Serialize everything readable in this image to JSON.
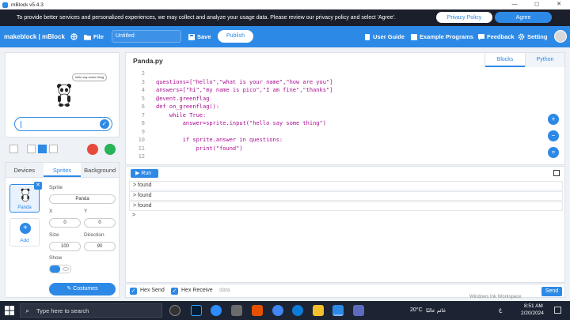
{
  "titlebar": {
    "title": "mBlock v5.4.3",
    "min": "—",
    "max": "◻",
    "close": "✕"
  },
  "privacy": {
    "message": "To provide better services and personalized experiences, we may collect and analyze your usage data. Please review our privacy policy and select 'Agree'.",
    "policy_label": "Privacy Policy",
    "agree_label": "Agree"
  },
  "menubar": {
    "logo": "makeblock | mBlock",
    "file": "File",
    "project_title": "Untitled",
    "save": "Save",
    "publish": "Publish",
    "user_guide": "User Guide",
    "example_programs": "Example Programs",
    "feedback": "Feedback",
    "setting": "Setting"
  },
  "stage": {
    "bubble_text": "hello say some thing"
  },
  "sprites_panel": {
    "tabs": [
      "Devices",
      "Sprites",
      "Background"
    ],
    "sprite_card_label": "Panda",
    "add_label": "Add",
    "sprite_label": "Sprite",
    "sprite_name": "Panda",
    "x_label": "X",
    "y_label": "Y",
    "x_value": "0",
    "y_value": "0",
    "size_label": "Size",
    "direction_label": "Direction",
    "size_value": "100",
    "direction_value": "90",
    "show_label": "Show",
    "costumes_label": "Costumes"
  },
  "editor": {
    "filename": "Panda.py",
    "mode_tabs": [
      "Blocks",
      "Python"
    ],
    "lines": [
      {
        "n": "2",
        "code": ""
      },
      {
        "n": "3",
        "code": "questions=[\"hello\",\"what is your name\",\"how are you\"]"
      },
      {
        "n": "4",
        "code": "answers=[\"hi\",\"my name is pico\",\"I am fine\",\"thanks\"]"
      },
      {
        "n": "5",
        "code": "@event.greenflag"
      },
      {
        "n": "6",
        "code": "def on_greenflag():"
      },
      {
        "n": "7",
        "code": "    while True:"
      },
      {
        "n": "8",
        "code": "        answer=sprite.input(\"hello say some thing\")"
      },
      {
        "n": "9",
        "code": ""
      },
      {
        "n": "10",
        "code": "        if sprite.answer in questions:"
      },
      {
        "n": "11",
        "code": "            print(\"found\")"
      },
      {
        "n": "12",
        "code": ""
      }
    ]
  },
  "console": {
    "run_label": "Run",
    "rows": [
      "found",
      "found",
      "found",
      ""
    ]
  },
  "footer": {
    "hex_send": "Hex Send",
    "hex_receive": "Hex Receive",
    "input_placeholder": "data",
    "send_label": "Send"
  },
  "taskbar": {
    "search_placeholder": "Type here to search",
    "weather": "20°C",
    "weather_arabic": "غائم عالبًا",
    "time": "8:51 AM",
    "date": "2/20/2024",
    "lang": "ع"
  },
  "watermark": "Windows Ink Workspace",
  "colors": {
    "accent": "#2d89e6",
    "privacy_bg": "#1b1f2b",
    "taskbar_bg": "#1c2433"
  }
}
